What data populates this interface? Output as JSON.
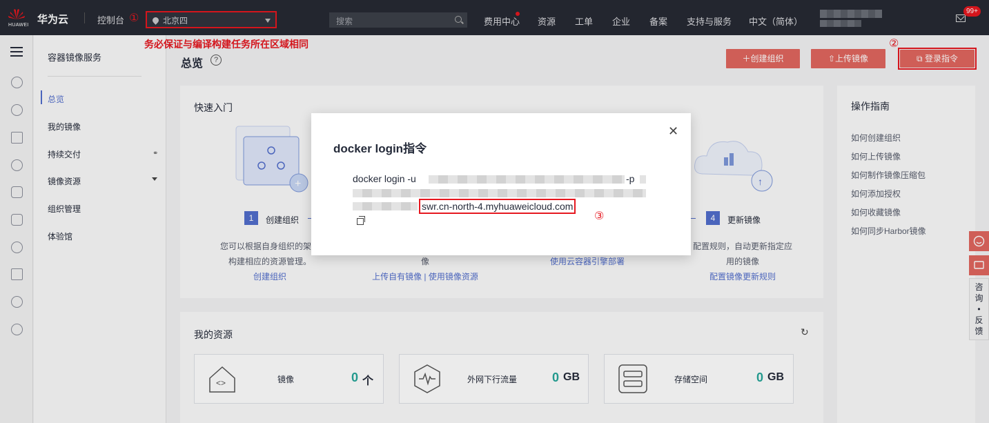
{
  "topbar": {
    "logo_text": "HUAWEI",
    "brand": "华为云",
    "console": "控制台",
    "annotation1": "①",
    "region": "北京四",
    "search_placeholder": "搜索",
    "nav": [
      "费用中心",
      "资源",
      "工单",
      "企业",
      "备案",
      "支持与服务",
      "中文（简体）"
    ],
    "badge": "99+"
  },
  "side": {
    "service": "容器镜像服务",
    "items": [
      "总览",
      "我的镜像",
      "持续交付",
      "镜像资源",
      "组织管理",
      "体验馆"
    ],
    "link_icon": "link-icon"
  },
  "main": {
    "warning": "务必保证与编译构建任务所在区域相同",
    "title": "总览",
    "buttons": {
      "create_org": "创建组织",
      "upload": "上传镜像",
      "login": "登录指令"
    },
    "annotation2": "②",
    "quick_start": {
      "title": "快速入门",
      "steps": [
        {
          "num": "1",
          "label": "创建组织"
        },
        {
          "num": "4",
          "label": "更新镜像"
        }
      ],
      "desc1_a": "您可以根据自身组织的架构",
      "desc1_b": "构建相应的资源管理。",
      "link1": "创建组织",
      "desc2_b": "像",
      "link2": "上传自有镜像 | 使用镜像资源",
      "link3": "使用云容器引擎部署",
      "desc4_a": "配置规则，自动更新指定应",
      "desc4_b": "用的镜像",
      "link4": "配置镜像更新规则"
    },
    "resources": {
      "title": "我的资源",
      "items": [
        {
          "label": "镜像",
          "value": "0",
          "unit": "个"
        },
        {
          "label": "外网下行流量",
          "value": "0",
          "unit": "GB"
        },
        {
          "label": "存储空间",
          "value": "0",
          "unit": "GB"
        }
      ]
    }
  },
  "guide": {
    "title": "操作指南",
    "links": [
      "如何创建组织",
      "如何上传镜像",
      "如何制作镜像压缩包",
      "如何添加授权",
      "如何收藏镜像",
      "如何同步Harbor镜像"
    ]
  },
  "float": {
    "feedback": [
      "咨",
      "询",
      "•",
      "反",
      "馈"
    ]
  },
  "modal": {
    "title": "docker login指令",
    "cmd_prefix": "docker login -u",
    "cmd_p": "-p",
    "endpoint": "swr.cn-north-4.myhuaweicloud.com",
    "annotation3": "③"
  },
  "colors": {
    "accent": "#526ecc",
    "brand_red": "#e1675f",
    "annotation_red": "#e6171f",
    "topbar": "#262a33",
    "teal": "#26a69a"
  }
}
